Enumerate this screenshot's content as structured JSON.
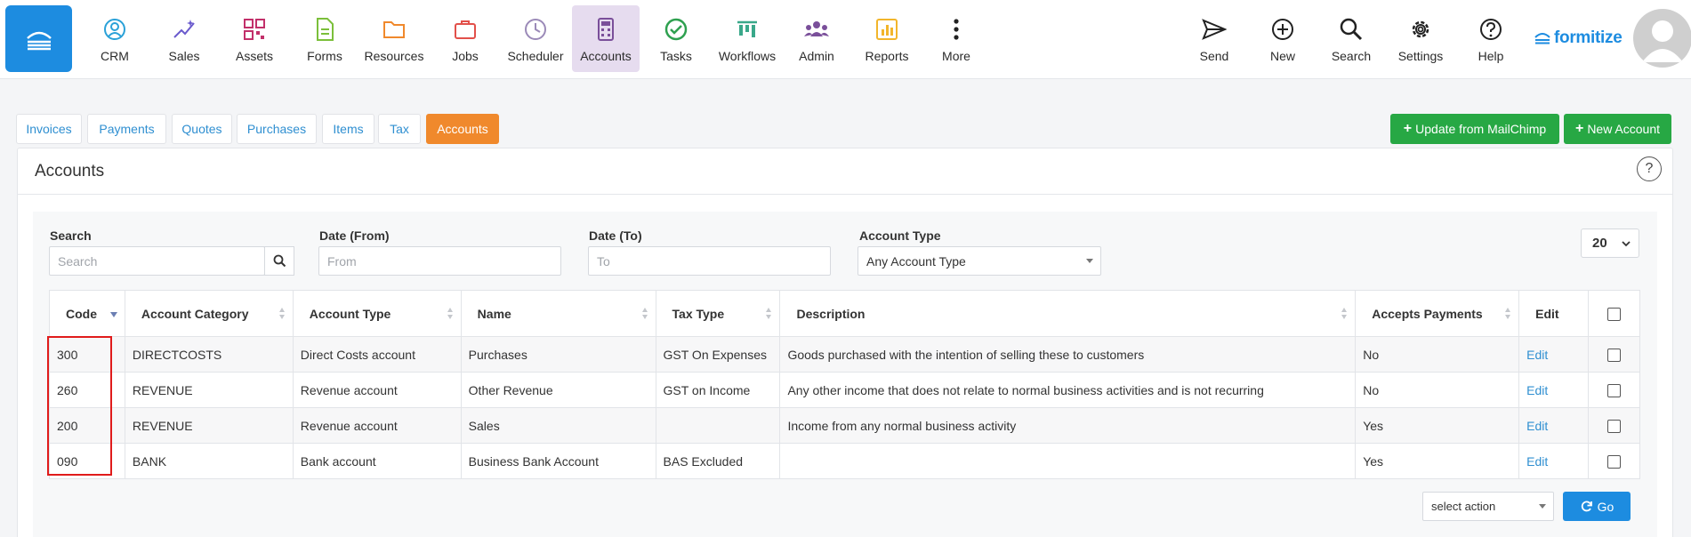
{
  "nav": {
    "items": [
      {
        "label": "CRM",
        "icon": "crm-icon"
      },
      {
        "label": "Sales",
        "icon": "sales-icon"
      },
      {
        "label": "Assets",
        "icon": "assets-icon"
      },
      {
        "label": "Forms",
        "icon": "forms-icon"
      },
      {
        "label": "Resources",
        "icon": "resources-icon"
      },
      {
        "label": "Jobs",
        "icon": "jobs-icon"
      },
      {
        "label": "Scheduler",
        "icon": "scheduler-icon"
      },
      {
        "label": "Accounts",
        "icon": "accounts-icon",
        "active": true
      },
      {
        "label": "Tasks",
        "icon": "tasks-icon"
      },
      {
        "label": "Workflows",
        "icon": "workflows-icon"
      },
      {
        "label": "Admin",
        "icon": "admin-icon"
      },
      {
        "label": "Reports",
        "icon": "reports-icon"
      },
      {
        "label": "More",
        "icon": "more-icon"
      }
    ],
    "right_items": [
      {
        "label": "Send",
        "icon": "send-icon"
      },
      {
        "label": "New",
        "icon": "new-icon"
      },
      {
        "label": "Search",
        "icon": "search-icon"
      },
      {
        "label": "Settings",
        "icon": "settings-icon"
      },
      {
        "label": "Help",
        "icon": "help-icon"
      }
    ],
    "logo_text": "formitize"
  },
  "tabs": [
    {
      "label": "Invoices"
    },
    {
      "label": "Payments"
    },
    {
      "label": "Quotes"
    },
    {
      "label": "Purchases"
    },
    {
      "label": "Items"
    },
    {
      "label": "Tax"
    },
    {
      "label": "Accounts",
      "active": true
    }
  ],
  "buttons": {
    "mailchimp": "Update from MailChimp",
    "new_account": "New Account",
    "go": "Go"
  },
  "panel": {
    "title": "Accounts",
    "help": "?"
  },
  "filters": {
    "search_label": "Search",
    "search_placeholder": "Search",
    "date_from_label": "Date (From)",
    "date_from_placeholder": "From",
    "date_to_label": "Date (To)",
    "date_to_placeholder": "To",
    "account_type_label": "Account Type",
    "account_type_value": "Any Account Type",
    "page_size": "20"
  },
  "table": {
    "headers": [
      "Code",
      "Account Category",
      "Account Type",
      "Name",
      "Tax Type",
      "Description",
      "Accepts Payments",
      "Edit"
    ],
    "rows": [
      {
        "code": "300",
        "category": "DIRECTCOSTS",
        "type": "Direct Costs account",
        "name": "Purchases",
        "tax": "GST On Expenses",
        "description": "Goods purchased with the intention of selling these to customers",
        "accepts": "No",
        "edit": "Edit"
      },
      {
        "code": "260",
        "category": "REVENUE",
        "type": "Revenue account",
        "name": "Other Revenue",
        "tax": "GST on Income",
        "description": "Any other income that does not relate to normal business activities and is not recurring",
        "accepts": "No",
        "edit": "Edit"
      },
      {
        "code": "200",
        "category": "REVENUE",
        "type": "Revenue account",
        "name": "Sales",
        "tax": "",
        "description": "Income from any normal business activity",
        "accepts": "Yes",
        "edit": "Edit"
      },
      {
        "code": "090",
        "category": "BANK",
        "type": "Bank account",
        "name": "Business Bank Account",
        "tax": "BAS Excluded",
        "description": "",
        "accepts": "Yes",
        "edit": "Edit"
      }
    ]
  },
  "bulk": {
    "action_placeholder": "select action"
  },
  "colors": {
    "primary": "#1d8ce0",
    "orange": "#f0892c",
    "green": "#27a844",
    "highlight": "#e01b1b",
    "active_nav": "#e6dcef"
  }
}
